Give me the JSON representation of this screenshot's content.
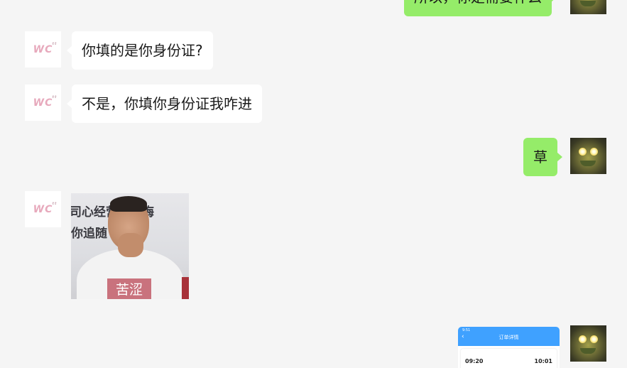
{
  "colors": {
    "background": "#f5f5f5",
    "incoming_bubble": "#ffffff",
    "outgoing_bubble": "#95ec69",
    "text": "#191919"
  },
  "contact_avatar": {
    "text": "WC",
    "superscript": "tt"
  },
  "my_avatar": {
    "icon": "glowing-eyed-frog-avatar"
  },
  "messages": [
    {
      "side": "out",
      "text": "所以，你是需要什么"
    },
    {
      "side": "in",
      "text": "你填的是你身份证?"
    },
    {
      "side": "in",
      "text": "不是，你填你身份证我咋进"
    },
    {
      "side": "out",
      "text": "草"
    },
    {
      "side": "in",
      "type": "sticker",
      "banner_line1": "司心经营，无悔",
      "banner_line2": "你追随",
      "caption": "苦涩"
    },
    {
      "side": "out",
      "type": "screenshot",
      "header": "订单详情",
      "status_time": "9:51",
      "departure_time": "09:20",
      "arrival_time": "10:01"
    }
  ]
}
